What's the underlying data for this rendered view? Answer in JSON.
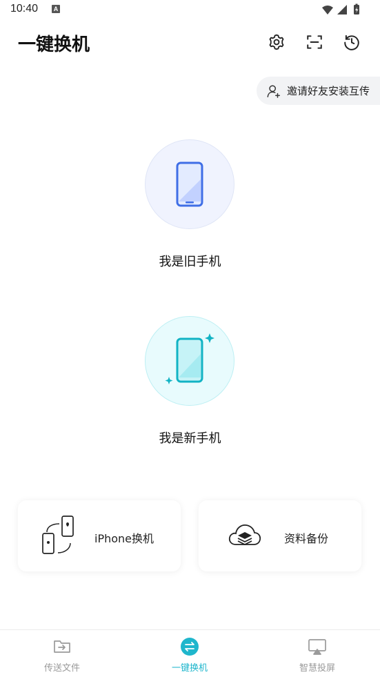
{
  "status_bar": {
    "time": "10:40",
    "notification_badge": "A"
  },
  "header": {
    "title": "一键换机",
    "icons": [
      "gear-icon",
      "scan-icon",
      "history-icon"
    ]
  },
  "invite": {
    "label": "邀请好友安装互传"
  },
  "old_phone": {
    "label": "我是旧手机"
  },
  "new_phone": {
    "label": "我是新手机"
  },
  "cards": {
    "iphone": {
      "label": "iPhone换机"
    },
    "backup": {
      "label": "资料备份"
    }
  },
  "bottom_nav": {
    "items": [
      {
        "label": "传送文件",
        "icon": "folder-transfer-icon",
        "active": false
      },
      {
        "label": "一键换机",
        "icon": "switch-arrows-icon",
        "active": true
      },
      {
        "label": "智慧投屏",
        "icon": "screen-cast-icon",
        "active": false
      }
    ]
  },
  "colors": {
    "accent": "#1fb6cc",
    "old_phone_blue": "#3f6ee6",
    "new_phone_teal": "#12b3c4"
  }
}
